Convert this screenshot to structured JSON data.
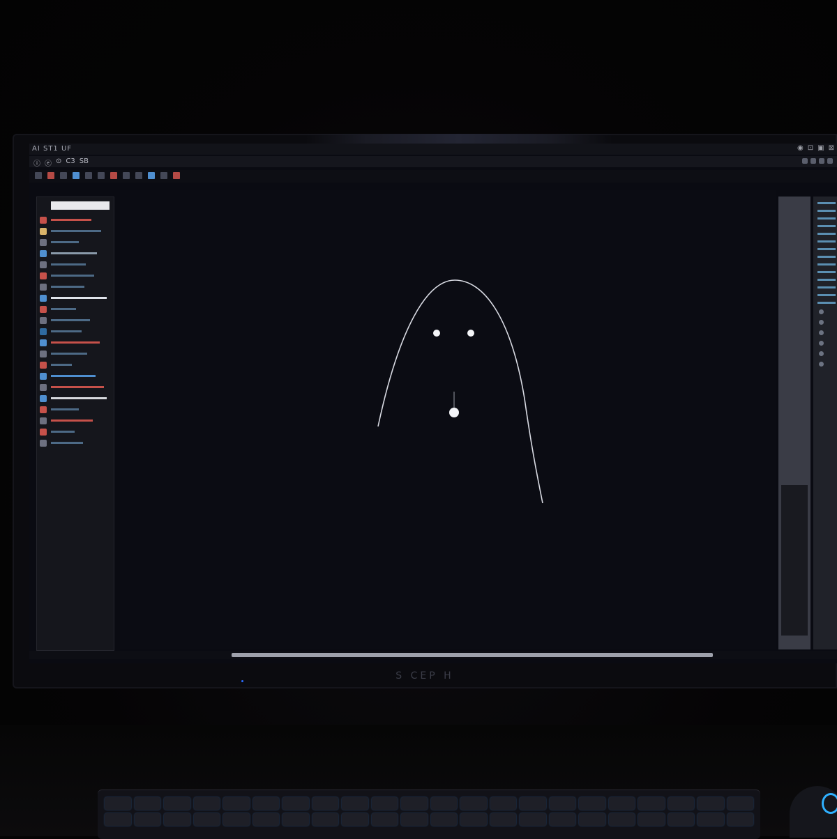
{
  "window": {
    "title": "AI ST1 UF",
    "controls": [
      "◉",
      "⊡",
      "▣",
      "⊠"
    ]
  },
  "menubar": {
    "items": [
      "ⓘ",
      "ⓔ",
      "⊙",
      "C3",
      "SB"
    ]
  },
  "canvas": {
    "subject": "ghost"
  },
  "monitor": {
    "brand": "S CEP H"
  },
  "colors": {
    "accent_blue": "#2fb0ff",
    "panel_red": "#b54a45",
    "panel_blue": "#4f8fd0"
  }
}
